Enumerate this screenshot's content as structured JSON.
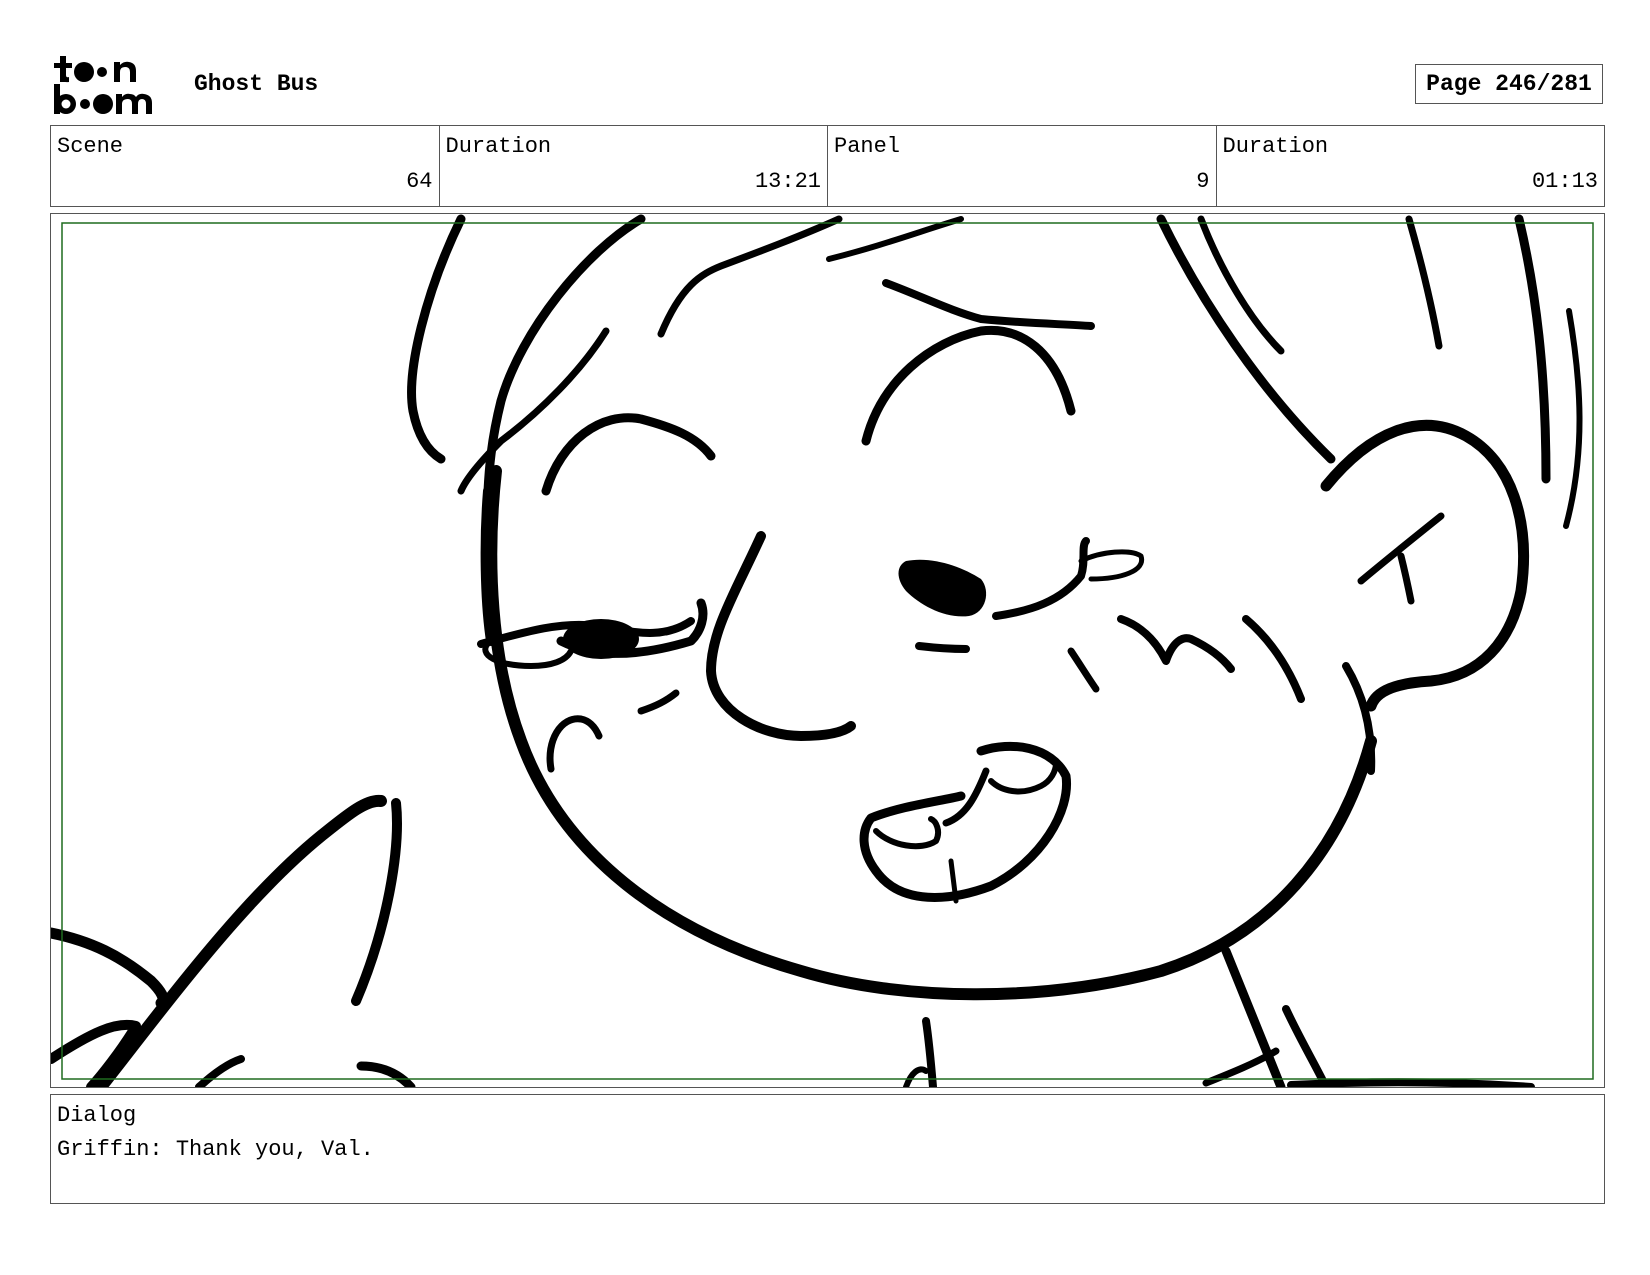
{
  "header": {
    "logo": {
      "text": "toon boom",
      "icon": "toon-boom-logo"
    },
    "project_title": "Ghost Bus",
    "page_label": "Page 246/281"
  },
  "info": {
    "scene_label": "Scene",
    "scene_value": "64",
    "scene_duration_label": "Duration",
    "scene_duration_value": "13:21",
    "panel_label": "Panel",
    "panel_value": "9",
    "panel_duration_label": "Duration",
    "panel_duration_value": "01:13"
  },
  "panel": {
    "safe_frame_color": "#1f6b1f",
    "ink_color": "#000000"
  },
  "dialog": {
    "label": "Dialog",
    "text": "Griffin: Thank you, Val."
  }
}
